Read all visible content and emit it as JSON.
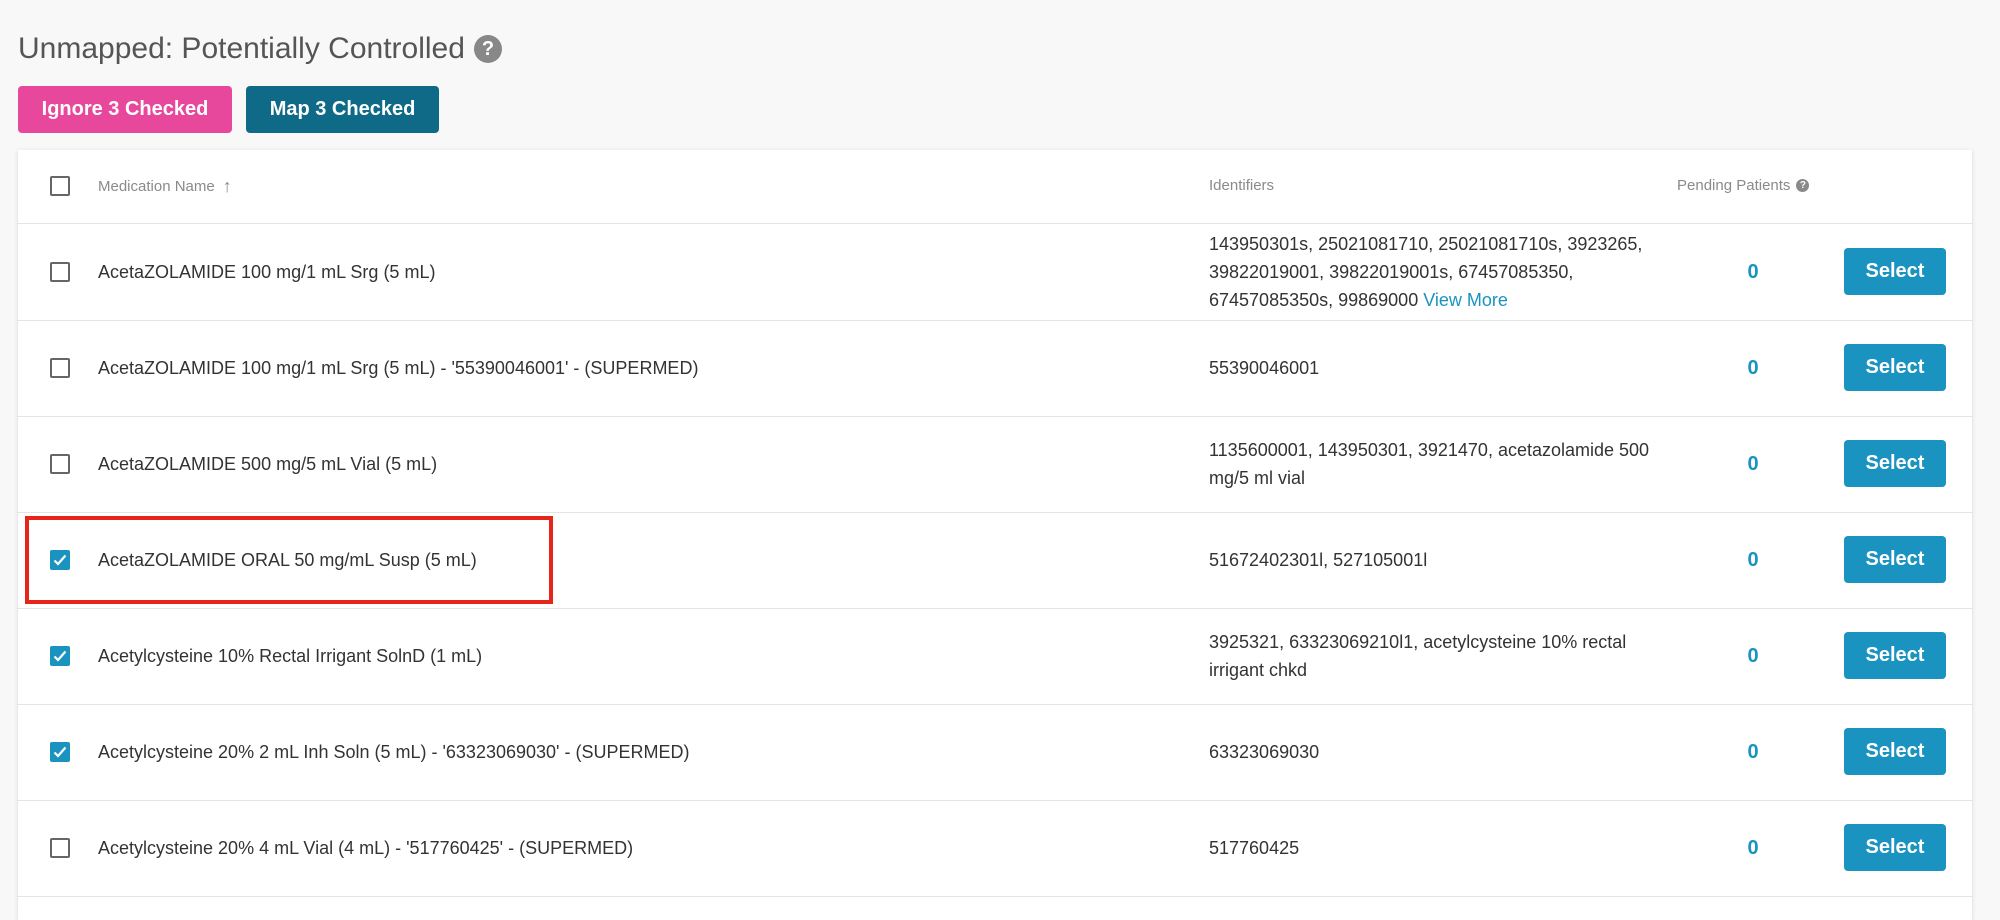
{
  "page": {
    "title": "Unmapped: Potentially Controlled",
    "help_icon": "?"
  },
  "actions": {
    "ignore_label": "Ignore 3 Checked",
    "map_label": "Map 3 Checked"
  },
  "colors": {
    "ignore_button": "#e8489c",
    "map_button": "#0e6a87",
    "accent": "#1a93c0",
    "highlight": "#e8231a"
  },
  "table": {
    "headers": {
      "medication_name": "Medication Name",
      "identifiers": "Identifiers",
      "pending_patients": "Pending Patients"
    },
    "sort_icon": "↑",
    "header_help_icon": "?",
    "rows": [
      {
        "checked": false,
        "name": "AcetaZOLAMIDE 100 mg/1 mL Srg (5 mL)",
        "identifiers": "143950301s, 25021081710, 25021081710s, 3923265, 39822019001, 39822019001s, 67457085350, 67457085350s, 99869000",
        "view_more": "View More",
        "pending": "0",
        "select_label": "Select"
      },
      {
        "checked": false,
        "name": "AcetaZOLAMIDE 100 mg/1 mL Srg (5 mL) - '55390046001' - (SUPERMED)",
        "identifiers": "55390046001",
        "pending": "0",
        "select_label": "Select"
      },
      {
        "checked": false,
        "name": "AcetaZOLAMIDE 500 mg/5 mL Vial (5 mL)",
        "identifiers": "1135600001, 143950301, 3921470, acetazolamide 500 mg/5 ml vial",
        "pending": "0",
        "select_label": "Select"
      },
      {
        "checked": true,
        "name": "AcetaZOLAMIDE ORAL 50 mg/mL Susp (5 mL)",
        "identifiers": "51672402301l, 527105001l",
        "pending": "0",
        "select_label": "Select",
        "highlighted": true
      },
      {
        "checked": true,
        "name": "Acetylcysteine 10% Rectal Irrigant SolnD (1 mL)",
        "identifiers": "3925321, 63323069210l1, acetylcysteine 10% rectal irrigant chkd",
        "pending": "0",
        "select_label": "Select"
      },
      {
        "checked": true,
        "name": "Acetylcysteine 20% 2 mL Inh Soln (5 mL) - '63323069030' - (SUPERMED)",
        "identifiers": "63323069030",
        "pending": "0",
        "select_label": "Select"
      },
      {
        "checked": false,
        "name": "Acetylcysteine 20% 4 mL Vial (4 mL) - '517760425' - (SUPERMED)",
        "identifiers": "517760425",
        "pending": "0",
        "select_label": "Select"
      }
    ]
  }
}
